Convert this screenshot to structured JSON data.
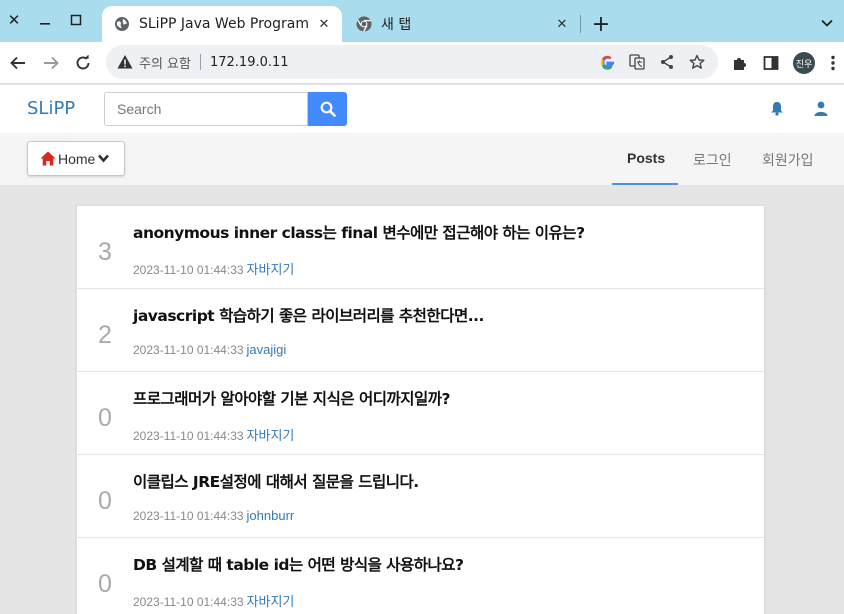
{
  "browser": {
    "tabs": [
      {
        "title": "SLiPP Java Web Program",
        "active": true
      },
      {
        "title": "새 탭",
        "active": false
      }
    ],
    "security_label": "주의 요함",
    "url": "172.19.0.11",
    "avatar_text": "진우"
  },
  "site": {
    "brand": "SLiPP",
    "search_placeholder": "Search",
    "home_label": "Home",
    "nav_links": [
      "Posts",
      "로그인",
      "회원가입"
    ],
    "accent_color": "#337ab7"
  },
  "posts": [
    {
      "count": "3",
      "subject": "anonymous inner class는 final 변수에만 접근해야 하는 이유는?",
      "date": "2023-11-10 01:44:33",
      "author": "자바지기"
    },
    {
      "count": "2",
      "subject": "javascript 학습하기 좋은 라이브러리를 추천한다면...",
      "date": "2023-11-10 01:44:33",
      "author": "javajigi"
    },
    {
      "count": "0",
      "subject": "프로그래머가 알아야할 기본 지식은 어디까지일까?",
      "date": "2023-11-10 01:44:33",
      "author": "자바지기"
    },
    {
      "count": "0",
      "subject": "이클립스 JRE설정에 대해서 질문을 드립니다.",
      "date": "2023-11-10 01:44:33",
      "author": "johnburr"
    },
    {
      "count": "0",
      "subject": "DB 설계할 때 table id는 어떤 방식을 사용하나요?",
      "date": "2023-11-10 01:44:33",
      "author": "자바지기"
    }
  ]
}
